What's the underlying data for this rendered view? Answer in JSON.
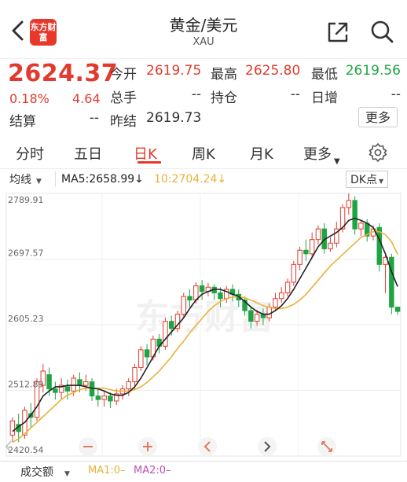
{
  "header": {
    "title": "黄金/美元",
    "subtitle": "XAU",
    "logo_text": "东方财富"
  },
  "quote": {
    "price": "2624.37",
    "change_pct": "0.18%",
    "change": "4.64",
    "fields": [
      {
        "label": "今开",
        "value": "2619.75",
        "color": "red"
      },
      {
        "label": "最高",
        "value": "2625.80",
        "color": "red"
      },
      {
        "label": "最低",
        "value": "2619.56",
        "color": "green"
      },
      {
        "label": "总手",
        "value": "--",
        "color": "dark"
      },
      {
        "label": "持仓",
        "value": "--",
        "color": "dark"
      },
      {
        "label": "日增",
        "value": "--",
        "color": "dark"
      },
      {
        "label": "结算",
        "value": "--",
        "color": "dark"
      },
      {
        "label": "昨结",
        "value": "2619.73",
        "color": "dark"
      }
    ],
    "more_label": "更多"
  },
  "tabs": [
    {
      "label": "分时"
    },
    {
      "label": "五日"
    },
    {
      "label": "日K",
      "active": true
    },
    {
      "label": "周K"
    },
    {
      "label": "月K"
    },
    {
      "label": "更多"
    }
  ],
  "indicators": {
    "ma_select": "均线",
    "ma5": "MA5:2658.99↓",
    "ma10": "10:2704.24↓",
    "dk": "DK点"
  },
  "bottom": {
    "volume_select": "成交额",
    "ma1": "MA1:0–",
    "ma2": "MA2:0–"
  },
  "colors": {
    "up": "#e23a2e",
    "down": "#1fa444",
    "ma5": "#222222",
    "ma10": "#e8b23a",
    "watermark": "#f2f2f2"
  },
  "chart_data": {
    "type": "candlestick",
    "ylim": [
      2420.54,
      2789.91
    ],
    "y_tick_labels": [
      "2789.91",
      "2697.57",
      "2605.23",
      "2512.89",
      "2420.54"
    ],
    "candles": [
      [
        2450,
        2470,
        2440,
        2475
      ],
      [
        2465,
        2455,
        2440,
        2480
      ],
      [
        2450,
        2485,
        2445,
        2490
      ],
      [
        2480,
        2475,
        2460,
        2495
      ],
      [
        2475,
        2525,
        2470,
        2530
      ],
      [
        2520,
        2540,
        2510,
        2550
      ],
      [
        2535,
        2515,
        2505,
        2545
      ],
      [
        2515,
        2510,
        2500,
        2525
      ],
      [
        2510,
        2520,
        2500,
        2530
      ],
      [
        2518,
        2512,
        2500,
        2528
      ],
      [
        2512,
        2530,
        2505,
        2535
      ],
      [
        2528,
        2520,
        2510,
        2538
      ],
      [
        2520,
        2525,
        2512,
        2535
      ],
      [
        2525,
        2505,
        2498,
        2530
      ],
      [
        2505,
        2500,
        2490,
        2515
      ],
      [
        2500,
        2505,
        2490,
        2512
      ],
      [
        2505,
        2498,
        2488,
        2510
      ],
      [
        2498,
        2508,
        2492,
        2515
      ],
      [
        2508,
        2515,
        2500,
        2520
      ],
      [
        2515,
        2525,
        2505,
        2530
      ],
      [
        2525,
        2545,
        2515,
        2550
      ],
      [
        2545,
        2570,
        2540,
        2575
      ],
      [
        2570,
        2560,
        2548,
        2578
      ],
      [
        2560,
        2585,
        2555,
        2590
      ],
      [
        2585,
        2575,
        2565,
        2592
      ],
      [
        2575,
        2610,
        2570,
        2615
      ],
      [
        2610,
        2600,
        2590,
        2618
      ],
      [
        2600,
        2620,
        2595,
        2625
      ],
      [
        2620,
        2645,
        2615,
        2650
      ],
      [
        2645,
        2640,
        2630,
        2655
      ],
      [
        2640,
        2660,
        2635,
        2665
      ],
      [
        2660,
        2652,
        2640,
        2668
      ],
      [
        2652,
        2658,
        2645,
        2664
      ],
      [
        2658,
        2650,
        2640,
        2662
      ],
      [
        2650,
        2642,
        2630,
        2658
      ],
      [
        2642,
        2655,
        2636,
        2660
      ],
      [
        2655,
        2648,
        2638,
        2662
      ],
      [
        2648,
        2640,
        2630,
        2655
      ],
      [
        2640,
        2625,
        2618,
        2645
      ],
      [
        2625,
        2610,
        2600,
        2632
      ],
      [
        2610,
        2620,
        2604,
        2626
      ],
      [
        2620,
        2615,
        2605,
        2628
      ],
      [
        2615,
        2630,
        2610,
        2635
      ],
      [
        2630,
        2642,
        2625,
        2650
      ],
      [
        2642,
        2650,
        2636,
        2658
      ],
      [
        2650,
        2665,
        2645,
        2670
      ],
      [
        2665,
        2690,
        2660,
        2695
      ],
      [
        2690,
        2710,
        2682,
        2715
      ],
      [
        2710,
        2705,
        2695,
        2725
      ],
      [
        2705,
        2725,
        2700,
        2735
      ],
      [
        2725,
        2740,
        2718,
        2745
      ],
      [
        2740,
        2712,
        2705,
        2748
      ],
      [
        2712,
        2720,
        2708,
        2728
      ],
      [
        2720,
        2740,
        2714,
        2750
      ],
      [
        2740,
        2770,
        2735,
        2775
      ],
      [
        2770,
        2780,
        2760,
        2790
      ],
      [
        2780,
        2740,
        2732,
        2786
      ],
      [
        2740,
        2748,
        2730,
        2752
      ],
      [
        2748,
        2730,
        2722,
        2754
      ],
      [
        2730,
        2740,
        2724,
        2745
      ],
      [
        2742,
        2690,
        2680,
        2748
      ],
      [
        2690,
        2700,
        2650,
        2705
      ],
      [
        2700,
        2630,
        2620,
        2705
      ],
      [
        2630,
        2624,
        2619,
        2626
      ]
    ],
    "ma5": [
      2455,
      2462,
      2468,
      2478,
      2490,
      2505,
      2512,
      2518,
      2518,
      2520,
      2520,
      2520,
      2518,
      2516,
      2515,
      2512,
      2508,
      2506,
      2506,
      2510,
      2518,
      2530,
      2545,
      2560,
      2575,
      2585,
      2595,
      2605,
      2615,
      2628,
      2640,
      2648,
      2652,
      2655,
      2655,
      2652,
      2648,
      2645,
      2638,
      2630,
      2624,
      2620,
      2620,
      2625,
      2632,
      2642,
      2655,
      2670,
      2685,
      2700,
      2715,
      2725,
      2730,
      2735,
      2742,
      2752,
      2755,
      2752,
      2748,
      2742,
      2725,
      2705,
      2680,
      2658.99
    ],
    "ma10": [
      2440,
      2445,
      2452,
      2460,
      2468,
      2476,
      2484,
      2492,
      2500,
      2506,
      2510,
      2514,
      2516,
      2516,
      2516,
      2516,
      2514,
      2512,
      2512,
      2512,
      2514,
      2518,
      2524,
      2532,
      2540,
      2550,
      2560,
      2572,
      2582,
      2594,
      2604,
      2614,
      2624,
      2632,
      2638,
      2642,
      2644,
      2645,
      2643,
      2640,
      2636,
      2632,
      2630,
      2628,
      2628,
      2630,
      2634,
      2640,
      2648,
      2658,
      2668,
      2678,
      2688,
      2696,
      2704,
      2712,
      2720,
      2728,
      2732,
      2736,
      2736,
      2732,
      2722,
      2704.24
    ]
  }
}
